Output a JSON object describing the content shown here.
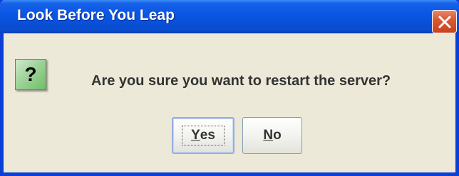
{
  "window": {
    "title": "Look Before You Leap",
    "close_icon": "close-icon"
  },
  "message": {
    "icon": "question-icon",
    "icon_glyph": "?",
    "text": "Are you sure you want to restart the server?"
  },
  "buttons": {
    "yes": {
      "mnemonic": "Y",
      "rest": "es",
      "focused": true
    },
    "no": {
      "mnemonic": "N",
      "rest": "o",
      "focused": false
    }
  },
  "colors": {
    "titlebar": "#0a56e3",
    "frame": "#0a3fd8",
    "dialog_bg": "#ece9d8",
    "close_button": "#d95a36",
    "question_icon_bg": "#9fd39a"
  }
}
